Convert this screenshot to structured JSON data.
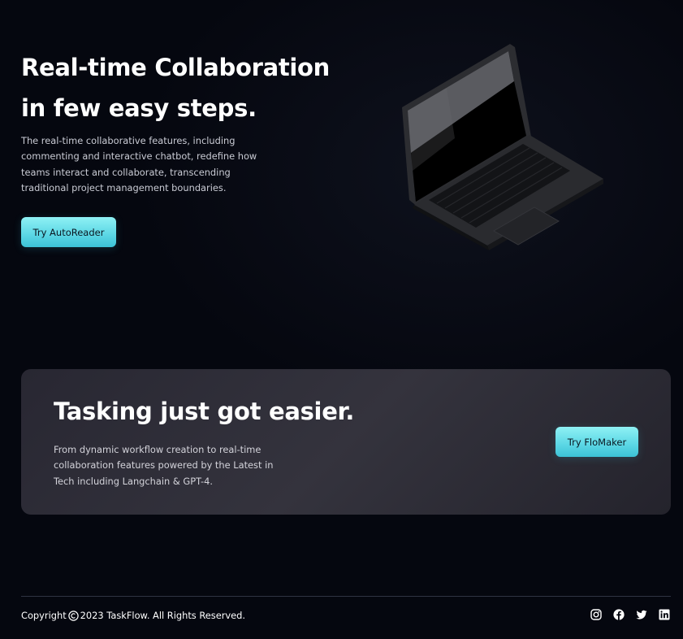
{
  "hero": {
    "title_line1": "Real-time Collaboration",
    "title_line2": "in few easy steps.",
    "description": "The real-time collaborative features, including commenting and interactive chatbot, redefine how teams interact and collaborate, transcending traditional project management boundaries.",
    "cta_label": "Try AutoReader"
  },
  "banner": {
    "title": "Tasking just got easier.",
    "description": "From dynamic workflow creation to real-time collaboration features powered by the Latest in Tech including Langchain & GPT-4.",
    "cta_label": "Try FloMaker"
  },
  "footer": {
    "copyright_prefix": "Copyright",
    "copyright_suffix": "2023 TaskFlow. All Rights Reserved.",
    "social_icons": [
      "instagram-icon",
      "facebook-icon",
      "twitter-icon",
      "linkedin-icon"
    ]
  },
  "colors": {
    "background": "#05070f",
    "accent": "#5fd9e6",
    "card": "#2d2c36"
  }
}
